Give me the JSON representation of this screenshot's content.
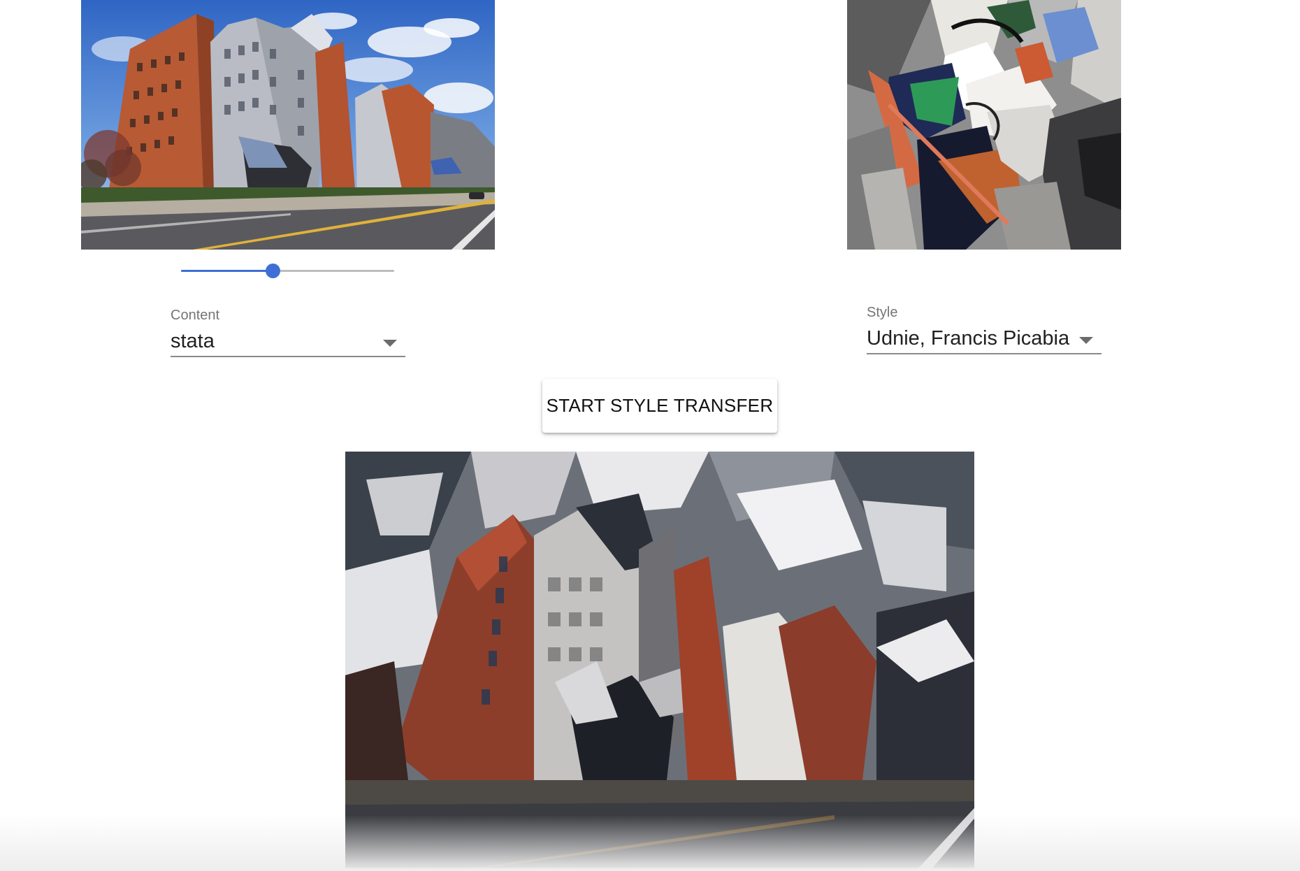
{
  "content_image": {
    "description_icon": "content-photo-stata-center"
  },
  "style_image": {
    "description_icon": "style-painting-udnie"
  },
  "result_image": {
    "description_icon": "stylized-result-image"
  },
  "slider": {
    "value_fraction": 0.43
  },
  "content_select": {
    "label": "Content",
    "value": "stata"
  },
  "style_select": {
    "label": "Style",
    "value": "Udnie, Francis Picabia"
  },
  "actions": {
    "start_label": "START STYLE TRANSFER"
  },
  "colors": {
    "accent": "#3f6fd6",
    "track": "#bdbdbd",
    "text_primary": "#212121",
    "text_secondary": "#757575"
  }
}
